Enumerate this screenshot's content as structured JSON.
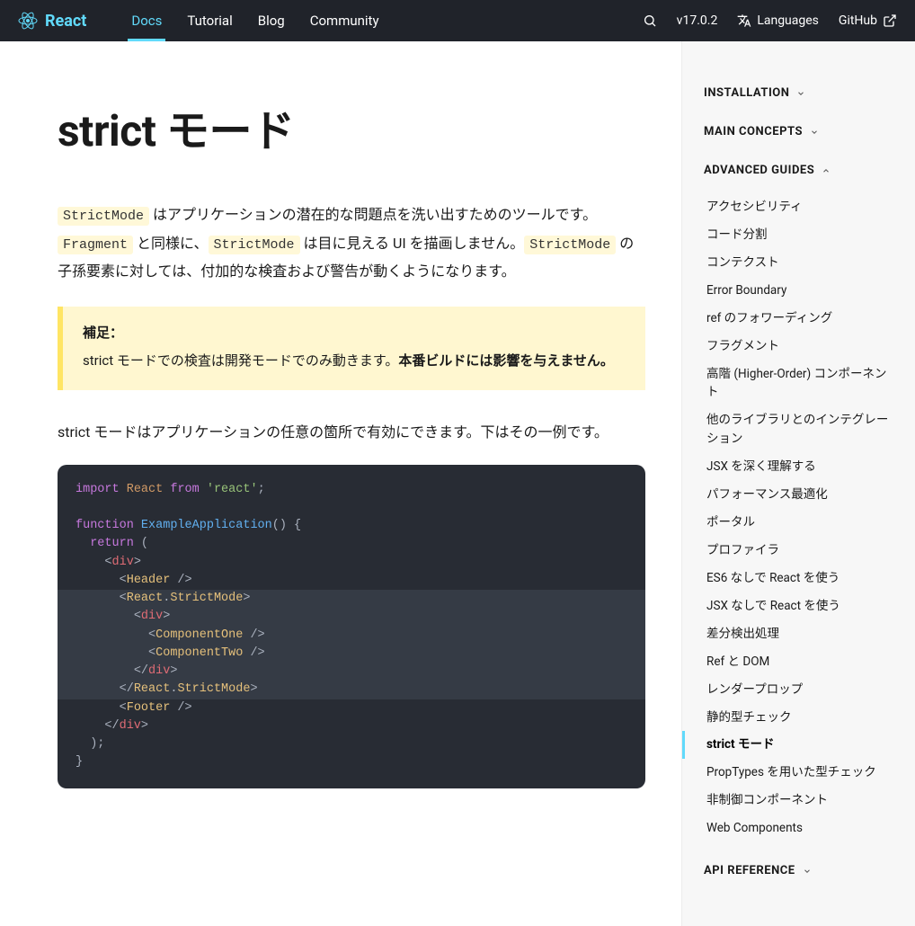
{
  "header": {
    "brand": "React",
    "nav": {
      "docs": "Docs",
      "tutorial": "Tutorial",
      "blog": "Blog",
      "community": "Community"
    },
    "version": "v17.0.2",
    "languages": "Languages",
    "github": "GitHub"
  },
  "page": {
    "title": "strict モード",
    "intro": {
      "c1": "StrictMode",
      "t1": " はアプリケーションの潜在的な問題点を洗い出すためのツールです。",
      "c2": "Fragment",
      "t2": " と同様に、",
      "c3": "StrictMode",
      "t3": " は目に見える UI を描画しません。",
      "c4": "StrictMode",
      "t4": " の子孫要素に対しては、付加的な検査および警告が動くようになります。"
    },
    "note": {
      "title": "補足：",
      "body1": "strict モードでの検査は開発モードでのみ動きます。",
      "bold": "本番ビルドには影響を与えません。"
    },
    "p2": "strict モードはアプリケーションの任意の箇所で有効にできます。下はその一例です。",
    "code": {
      "l1_kw1": "import",
      "l1_ident": "React",
      "l1_kw2": "from",
      "l1_str": "'react'",
      "l1_sc": ";",
      "l3_kw": "function",
      "l3_fn": "ExampleApplication",
      "l3_rest": "() {",
      "l4_kw": "return",
      "l4_rest": " (",
      "l5_o": "<",
      "l5_tag": "div",
      "l5_c": ">",
      "l6_o": "<",
      "l6_tag": "Header",
      "l6_c": " />",
      "l7_o": "<",
      "l7_ns": "React",
      "l7_dot": ".",
      "l7_tag": "StrictMode",
      "l7_c": ">",
      "l8_o": "<",
      "l8_tag": "div",
      "l8_c": ">",
      "l9_o": "<",
      "l9_tag": "ComponentOne",
      "l9_c": " />",
      "l10_o": "<",
      "l10_tag": "ComponentTwo",
      "l10_c": " />",
      "l11_o": "</",
      "l11_tag": "div",
      "l11_c": ">",
      "l12_o": "</",
      "l12_ns": "React",
      "l12_dot": ".",
      "l12_tag": "StrictMode",
      "l12_c": ">",
      "l13_o": "<",
      "l13_tag": "Footer",
      "l13_c": " />",
      "l14_o": "</",
      "l14_tag": "div",
      "l14_c": ">",
      "l15": "  );",
      "l16": "}"
    }
  },
  "sidebar": {
    "sections": {
      "installation": "INSTALLATION",
      "main_concepts": "MAIN CONCEPTS",
      "advanced_guides": "ADVANCED GUIDES",
      "api_reference": "API REFERENCE"
    },
    "advanced_items": [
      "アクセシビリティ",
      "コード分割",
      "コンテクスト",
      "Error Boundary",
      "ref のフォワーディング",
      "フラグメント",
      "高階 (Higher-Order) コンポーネント",
      "他のライブラリとのインテグレーション",
      "JSX を深く理解する",
      "パフォーマンス最適化",
      "ポータル",
      "プロファイラ",
      "ES6 なしで React を使う",
      "JSX なしで React を使う",
      "差分検出処理",
      "Ref と DOM",
      "レンダープロップ",
      "静的型チェック",
      "strict モード",
      "PropTypes を用いた型チェック",
      "非制御コンポーネント",
      "Web Components"
    ],
    "active_item_index": 18
  }
}
